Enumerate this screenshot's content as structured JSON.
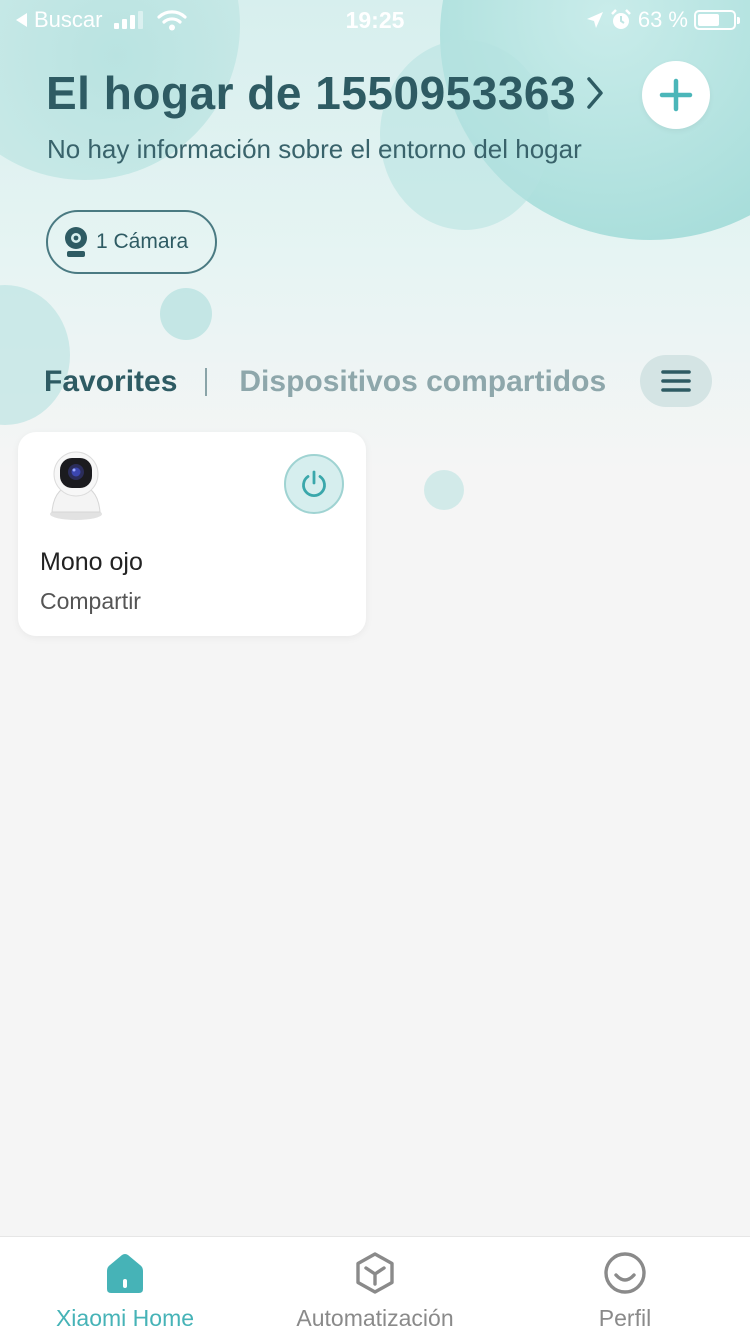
{
  "status_bar": {
    "back_app": "Buscar",
    "time": "19:25",
    "battery_text": "63 %",
    "battery_level": 0.63,
    "icons": [
      "back-arrow-icon",
      "signal-icon",
      "wifi-icon",
      "location-icon",
      "alarm-icon",
      "battery-icon"
    ]
  },
  "header": {
    "home_title": "El hogar de 1550953363",
    "subtitle": "No hay información sobre el entorno del hogar",
    "add_icon": "plus-icon",
    "device_summary": {
      "label": "1 Cámara",
      "icon": "camera-icon"
    }
  },
  "tabs": {
    "items": [
      {
        "label": "Favorites",
        "active": true
      },
      {
        "label": "Dispositivos compartidos",
        "active": false
      }
    ],
    "menu_icon": "menu-icon"
  },
  "devices": [
    {
      "name": "Mono ojo",
      "status": "Compartir",
      "image": "security-camera",
      "power_icon": "power-icon"
    }
  ],
  "bottom_nav": {
    "items": [
      {
        "label": "Xiaomi Home",
        "icon": "home-icon",
        "active": true
      },
      {
        "label": "Automatización",
        "icon": "automation-icon",
        "active": false
      },
      {
        "label": "Perfil",
        "icon": "profile-icon",
        "active": false
      }
    ]
  },
  "colors": {
    "accent": "#46b3b7",
    "title": "#2e5b63",
    "background": "#f5f5f5"
  }
}
